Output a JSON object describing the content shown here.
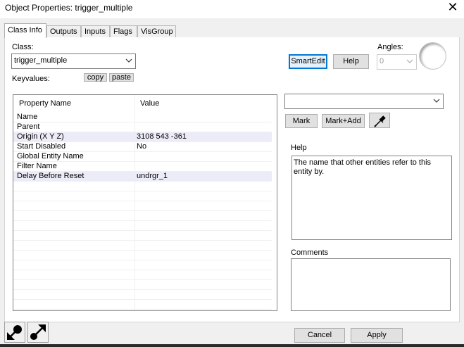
{
  "window": {
    "title": "Object Properties: trigger_multiple",
    "close_glyph": "✕"
  },
  "tabs": [
    {
      "label": "Class Info",
      "active": true
    },
    {
      "label": "Outputs"
    },
    {
      "label": "Inputs"
    },
    {
      "label": "Flags"
    },
    {
      "label": "VisGroup"
    }
  ],
  "class_section": {
    "class_label": "Class:",
    "class_value": "trigger_multiple",
    "keyvalues_label": "Keyvalues:",
    "copy_label": "copy",
    "paste_label": "paste"
  },
  "toolbar": {
    "smartedit_label": "SmartEdit",
    "help_label": "Help",
    "angles_label": "Angles:",
    "angles_value": "0"
  },
  "property_table": {
    "headers": [
      "Property Name",
      "Value"
    ],
    "rows": [
      {
        "name": "Name",
        "value": ""
      },
      {
        "name": "Parent",
        "value": ""
      },
      {
        "name": "Origin (X Y Z)",
        "value": "3108 543 -361",
        "highlight": true
      },
      {
        "name": "Start Disabled",
        "value": "No"
      },
      {
        "name": "Global Entity Name",
        "value": ""
      },
      {
        "name": "Filter Name",
        "value": ""
      },
      {
        "name": "Delay Before Reset",
        "value": "undrgr_1",
        "highlight": true
      }
    ]
  },
  "value_editor": {
    "dropdown_value": "",
    "mark_label": "Mark",
    "mark_add_label": "Mark+Add",
    "eyedropper_icon": "eyedropper-icon"
  },
  "help": {
    "label": "Help",
    "text": "The name that other entities refer to this entity by."
  },
  "comments": {
    "label": "Comments",
    "text": ""
  },
  "footer": {
    "cancel_label": "Cancel",
    "apply_label": "Apply",
    "pick_icon": "pin-link-icon",
    "pick_arrow_icon": "arrow-link-icon"
  },
  "colors": {
    "accent": "#0078d7",
    "row_highlight": "#ececf8",
    "window_bg": "#f0f0f0"
  }
}
